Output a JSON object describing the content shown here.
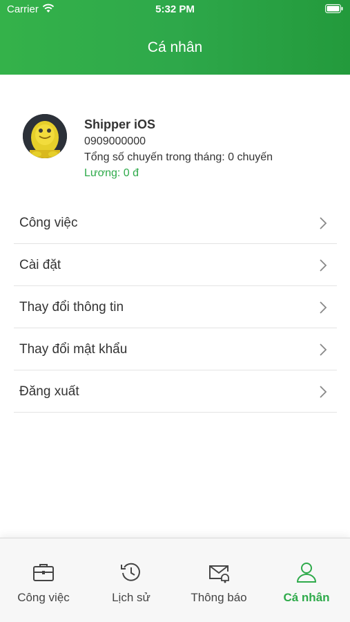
{
  "status_bar": {
    "carrier": "Carrier",
    "time": "5:32 PM"
  },
  "header": {
    "title": "Cá nhân"
  },
  "profile": {
    "name": "Shipper iOS",
    "phone": "0909000000",
    "trips": "Tổng số chuyến trong tháng: 0 chuyến",
    "salary": "Lương: 0 đ"
  },
  "menu": [
    {
      "label": "Công việc"
    },
    {
      "label": "Cài đặt"
    },
    {
      "label": "Thay đổi thông tin"
    },
    {
      "label": "Thay đổi mật khẩu"
    },
    {
      "label": "Đăng xuất"
    }
  ],
  "tabbar": [
    {
      "label": "Công việc",
      "icon": "briefcase-icon"
    },
    {
      "label": "Lịch sử",
      "icon": "history-icon"
    },
    {
      "label": "Thông báo",
      "icon": "mail-bell-icon"
    },
    {
      "label": "Cá nhân",
      "icon": "person-icon",
      "active": true
    }
  ],
  "colors": {
    "accent": "#2eaa4a",
    "header_start": "#34b24a",
    "header_end": "#239a3c"
  }
}
